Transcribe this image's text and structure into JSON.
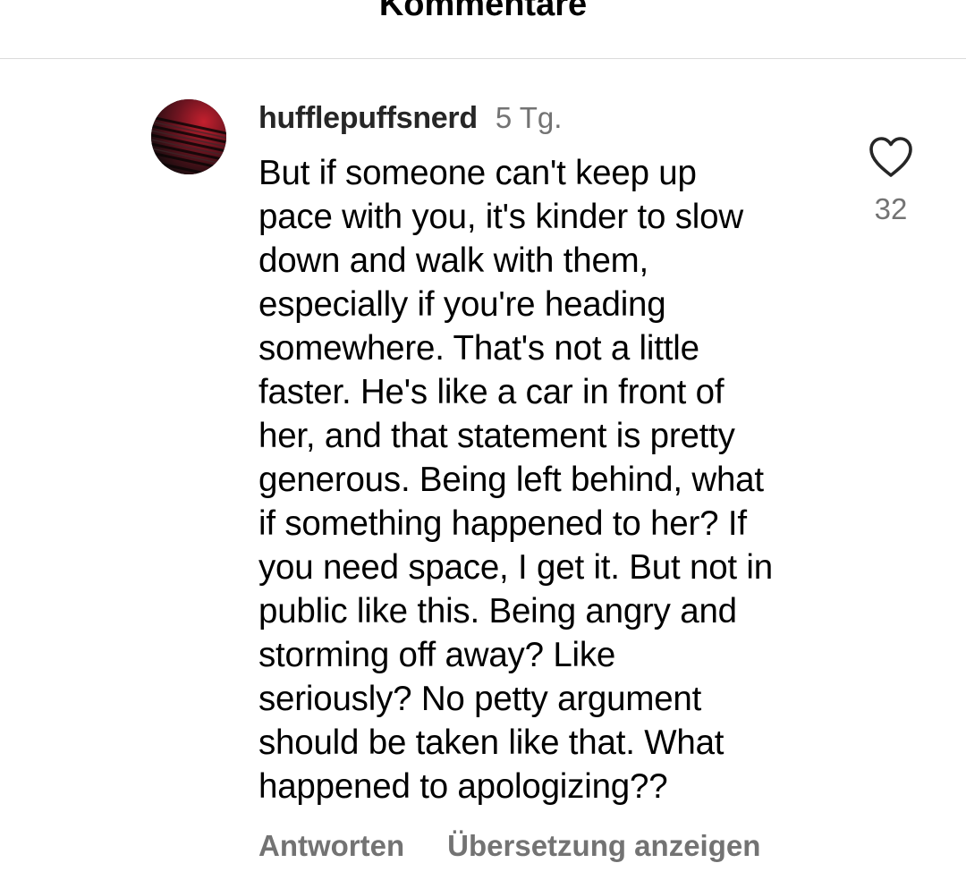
{
  "header": {
    "title": "Kommentare"
  },
  "comment": {
    "username": "hufflepuffsnerd",
    "age": "5 Tg.",
    "lines": [
      "But if someone can't keep up",
      "pace with you, it's kinder to slow",
      "down and walk with them,",
      "especially if you're heading",
      "somewhere. That's not a little",
      "faster. He's like a car in front of",
      "her, and that statement is pretty",
      "generous. Being left behind, what",
      "if something happened to her? If",
      "you need space, I get it. But not in",
      "public like this. Being angry and",
      "storming off away? Like",
      "seriously? No petty argument",
      "should be taken like that. What",
      "happened to apologizing??"
    ],
    "reply_label": "Antworten",
    "translate_label": "Übersetzung anzeigen",
    "like_count": "32",
    "like_icon": "heart-outline-icon"
  },
  "colors": {
    "text_primary": "#000000",
    "username": "#262626",
    "text_secondary": "#737373",
    "divider": "#dbdbdb",
    "background": "#ffffff"
  }
}
